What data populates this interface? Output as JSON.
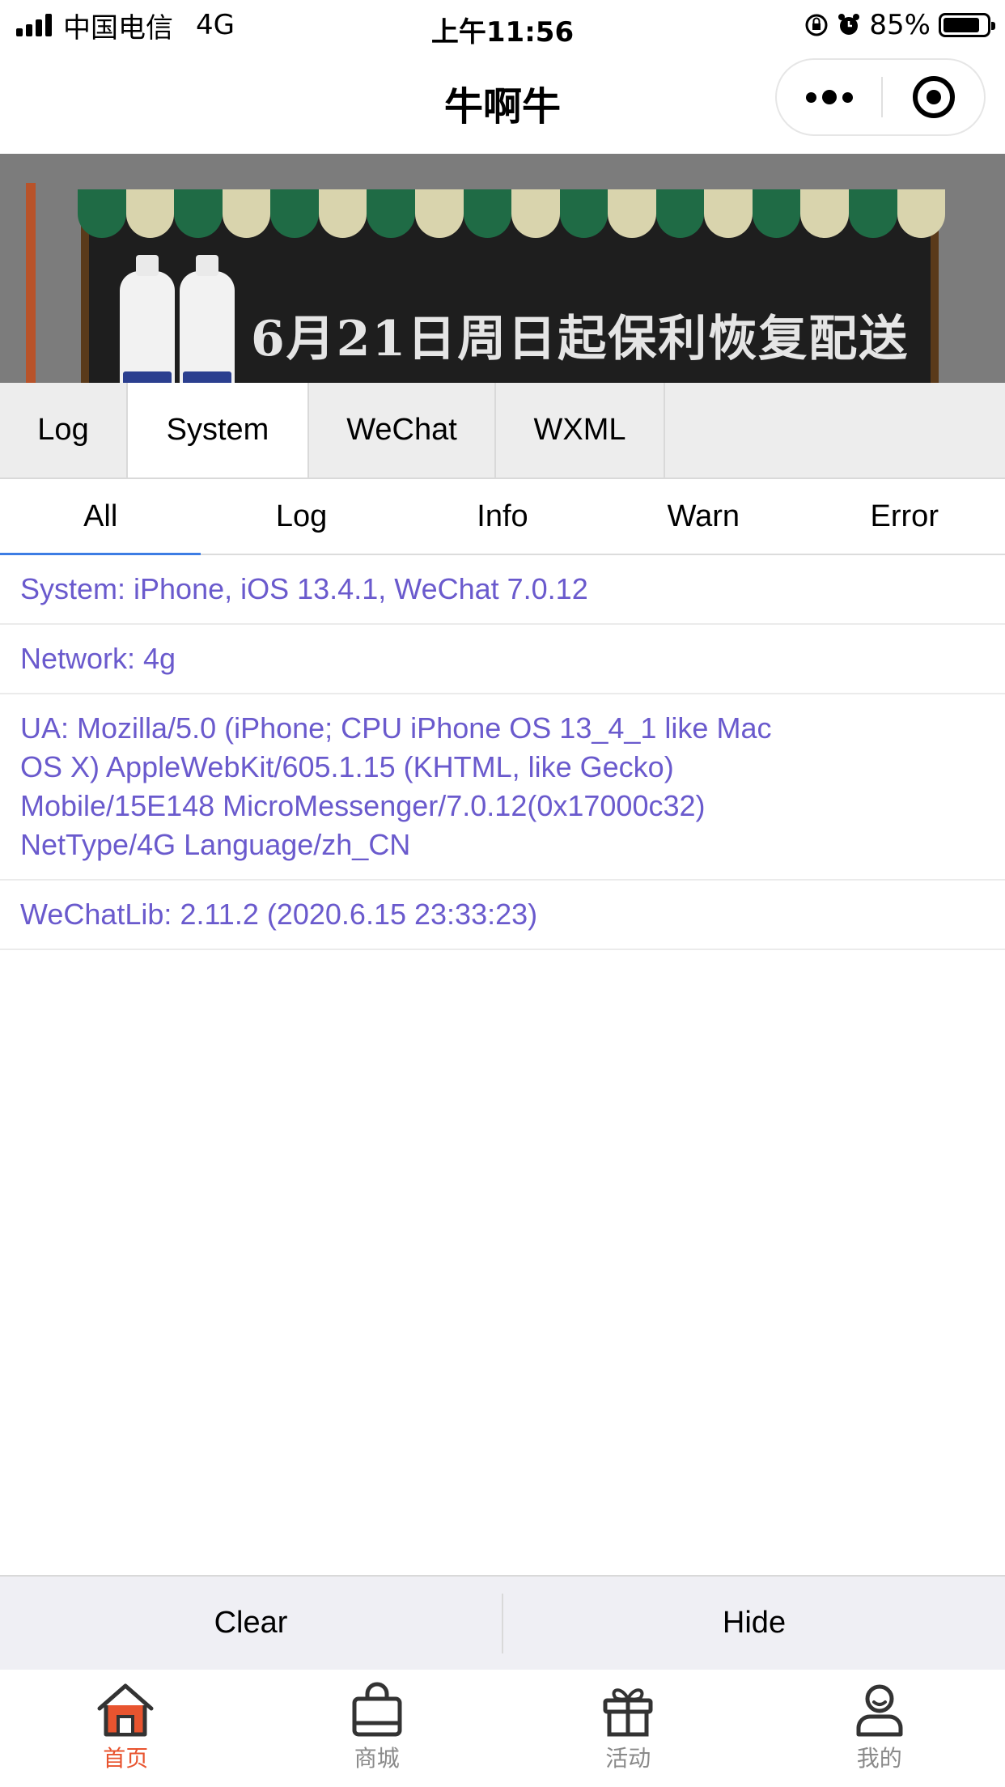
{
  "status_bar": {
    "carrier": "中国电信",
    "network": "4G",
    "time": "上午11:56",
    "battery": "85%"
  },
  "nav": {
    "title": "牛啊牛"
  },
  "banner": {
    "text": "6月21日周日起保利恢复配送"
  },
  "tabs": [
    {
      "label": "Log"
    },
    {
      "label": "System"
    },
    {
      "label": "WeChat"
    },
    {
      "label": "WXML"
    }
  ],
  "subtabs": [
    {
      "label": "All"
    },
    {
      "label": "Log"
    },
    {
      "label": "Info"
    },
    {
      "label": "Warn"
    },
    {
      "label": "Error"
    }
  ],
  "logs": {
    "system": "System: iPhone, iOS 13.4.1, WeChat 7.0.12",
    "network": "Network: 4g",
    "ua_lines": [
      "UA: Mozilla/5.0 (iPhone; CPU iPhone OS 13_4_1 like Mac",
      "OS X) AppleWebKit/605.1.15 (KHTML, like Gecko)",
      "Mobile/15E148 MicroMessenger/7.0.12(0x17000c32)",
      "NetType/4G Language/zh_CN"
    ],
    "wechatlib": "WeChatLib: 2.11.2 (2020.6.15 23:33:23)"
  },
  "actions": {
    "clear": "Clear",
    "hide": "Hide"
  },
  "tabbar": [
    {
      "label": "首页",
      "icon": "home-icon",
      "active": true
    },
    {
      "label": "商城",
      "icon": "shopping-bag-icon",
      "active": false
    },
    {
      "label": "活动",
      "icon": "gift-icon",
      "active": false
    },
    {
      "label": "我的",
      "icon": "user-icon",
      "active": false
    }
  ],
  "colors": {
    "log_text": "#6a5acd",
    "active_tab_underline": "#3d7de4",
    "tabbar_active": "#e8542f"
  }
}
